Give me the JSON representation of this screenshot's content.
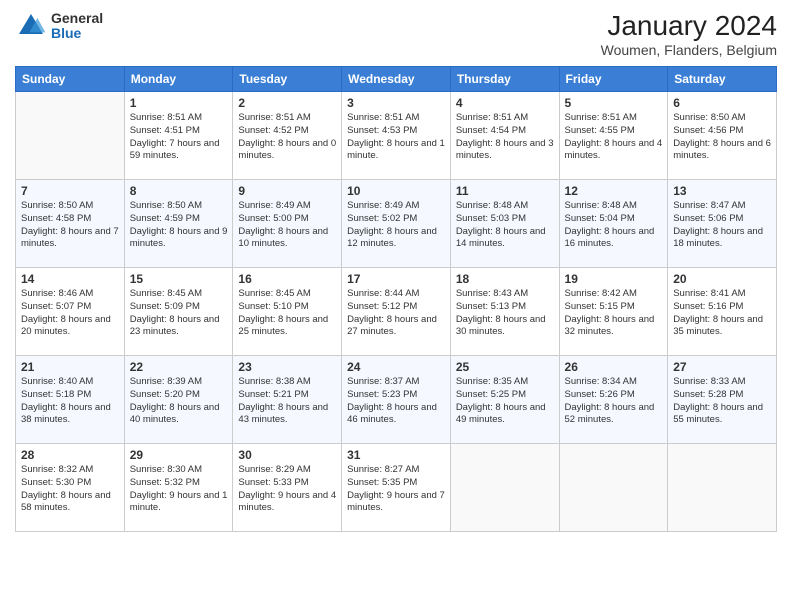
{
  "logo": {
    "general": "General",
    "blue": "Blue"
  },
  "header": {
    "month_year": "January 2024",
    "location": "Woumen, Flanders, Belgium"
  },
  "days": {
    "headers": [
      "Sunday",
      "Monday",
      "Tuesday",
      "Wednesday",
      "Thursday",
      "Friday",
      "Saturday"
    ]
  },
  "weeks": [
    {
      "cells": [
        {
          "empty": true
        },
        {
          "day": "1",
          "sunrise": "Sunrise: 8:51 AM",
          "sunset": "Sunset: 4:51 PM",
          "daylight": "Daylight: 7 hours and 59 minutes."
        },
        {
          "day": "2",
          "sunrise": "Sunrise: 8:51 AM",
          "sunset": "Sunset: 4:52 PM",
          "daylight": "Daylight: 8 hours and 0 minutes."
        },
        {
          "day": "3",
          "sunrise": "Sunrise: 8:51 AM",
          "sunset": "Sunset: 4:53 PM",
          "daylight": "Daylight: 8 hours and 1 minute."
        },
        {
          "day": "4",
          "sunrise": "Sunrise: 8:51 AM",
          "sunset": "Sunset: 4:54 PM",
          "daylight": "Daylight: 8 hours and 3 minutes."
        },
        {
          "day": "5",
          "sunrise": "Sunrise: 8:51 AM",
          "sunset": "Sunset: 4:55 PM",
          "daylight": "Daylight: 8 hours and 4 minutes."
        },
        {
          "day": "6",
          "sunrise": "Sunrise: 8:50 AM",
          "sunset": "Sunset: 4:56 PM",
          "daylight": "Daylight: 8 hours and 6 minutes."
        }
      ]
    },
    {
      "cells": [
        {
          "day": "7",
          "sunrise": "Sunrise: 8:50 AM",
          "sunset": "Sunset: 4:58 PM",
          "daylight": "Daylight: 8 hours and 7 minutes."
        },
        {
          "day": "8",
          "sunrise": "Sunrise: 8:50 AM",
          "sunset": "Sunset: 4:59 PM",
          "daylight": "Daylight: 8 hours and 9 minutes."
        },
        {
          "day": "9",
          "sunrise": "Sunrise: 8:49 AM",
          "sunset": "Sunset: 5:00 PM",
          "daylight": "Daylight: 8 hours and 10 minutes."
        },
        {
          "day": "10",
          "sunrise": "Sunrise: 8:49 AM",
          "sunset": "Sunset: 5:02 PM",
          "daylight": "Daylight: 8 hours and 12 minutes."
        },
        {
          "day": "11",
          "sunrise": "Sunrise: 8:48 AM",
          "sunset": "Sunset: 5:03 PM",
          "daylight": "Daylight: 8 hours and 14 minutes."
        },
        {
          "day": "12",
          "sunrise": "Sunrise: 8:48 AM",
          "sunset": "Sunset: 5:04 PM",
          "daylight": "Daylight: 8 hours and 16 minutes."
        },
        {
          "day": "13",
          "sunrise": "Sunrise: 8:47 AM",
          "sunset": "Sunset: 5:06 PM",
          "daylight": "Daylight: 8 hours and 18 minutes."
        }
      ]
    },
    {
      "cells": [
        {
          "day": "14",
          "sunrise": "Sunrise: 8:46 AM",
          "sunset": "Sunset: 5:07 PM",
          "daylight": "Daylight: 8 hours and 20 minutes."
        },
        {
          "day": "15",
          "sunrise": "Sunrise: 8:45 AM",
          "sunset": "Sunset: 5:09 PM",
          "daylight": "Daylight: 8 hours and 23 minutes."
        },
        {
          "day": "16",
          "sunrise": "Sunrise: 8:45 AM",
          "sunset": "Sunset: 5:10 PM",
          "daylight": "Daylight: 8 hours and 25 minutes."
        },
        {
          "day": "17",
          "sunrise": "Sunrise: 8:44 AM",
          "sunset": "Sunset: 5:12 PM",
          "daylight": "Daylight: 8 hours and 27 minutes."
        },
        {
          "day": "18",
          "sunrise": "Sunrise: 8:43 AM",
          "sunset": "Sunset: 5:13 PM",
          "daylight": "Daylight: 8 hours and 30 minutes."
        },
        {
          "day": "19",
          "sunrise": "Sunrise: 8:42 AM",
          "sunset": "Sunset: 5:15 PM",
          "daylight": "Daylight: 8 hours and 32 minutes."
        },
        {
          "day": "20",
          "sunrise": "Sunrise: 8:41 AM",
          "sunset": "Sunset: 5:16 PM",
          "daylight": "Daylight: 8 hours and 35 minutes."
        }
      ]
    },
    {
      "cells": [
        {
          "day": "21",
          "sunrise": "Sunrise: 8:40 AM",
          "sunset": "Sunset: 5:18 PM",
          "daylight": "Daylight: 8 hours and 38 minutes."
        },
        {
          "day": "22",
          "sunrise": "Sunrise: 8:39 AM",
          "sunset": "Sunset: 5:20 PM",
          "daylight": "Daylight: 8 hours and 40 minutes."
        },
        {
          "day": "23",
          "sunrise": "Sunrise: 8:38 AM",
          "sunset": "Sunset: 5:21 PM",
          "daylight": "Daylight: 8 hours and 43 minutes."
        },
        {
          "day": "24",
          "sunrise": "Sunrise: 8:37 AM",
          "sunset": "Sunset: 5:23 PM",
          "daylight": "Daylight: 8 hours and 46 minutes."
        },
        {
          "day": "25",
          "sunrise": "Sunrise: 8:35 AM",
          "sunset": "Sunset: 5:25 PM",
          "daylight": "Daylight: 8 hours and 49 minutes."
        },
        {
          "day": "26",
          "sunrise": "Sunrise: 8:34 AM",
          "sunset": "Sunset: 5:26 PM",
          "daylight": "Daylight: 8 hours and 52 minutes."
        },
        {
          "day": "27",
          "sunrise": "Sunrise: 8:33 AM",
          "sunset": "Sunset: 5:28 PM",
          "daylight": "Daylight: 8 hours and 55 minutes."
        }
      ]
    },
    {
      "cells": [
        {
          "day": "28",
          "sunrise": "Sunrise: 8:32 AM",
          "sunset": "Sunset: 5:30 PM",
          "daylight": "Daylight: 8 hours and 58 minutes."
        },
        {
          "day": "29",
          "sunrise": "Sunrise: 8:30 AM",
          "sunset": "Sunset: 5:32 PM",
          "daylight": "Daylight: 9 hours and 1 minute."
        },
        {
          "day": "30",
          "sunrise": "Sunrise: 8:29 AM",
          "sunset": "Sunset: 5:33 PM",
          "daylight": "Daylight: 9 hours and 4 minutes."
        },
        {
          "day": "31",
          "sunrise": "Sunrise: 8:27 AM",
          "sunset": "Sunset: 5:35 PM",
          "daylight": "Daylight: 9 hours and 7 minutes."
        },
        {
          "empty": true
        },
        {
          "empty": true
        },
        {
          "empty": true
        }
      ]
    }
  ]
}
